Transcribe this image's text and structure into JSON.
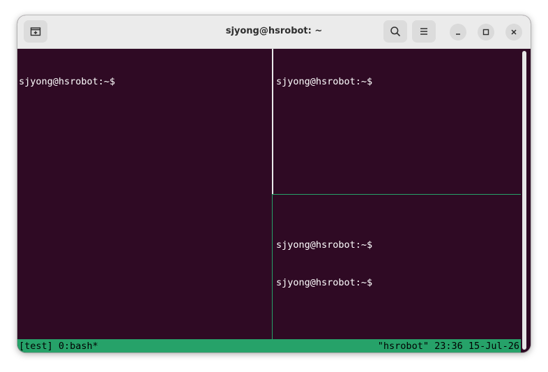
{
  "window": {
    "title": "sjyong@hsrobot: ~"
  },
  "titlebar": {
    "new_tab_icon": "new-tab-icon",
    "search_icon": "search-icon",
    "menu_icon": "hamburger-menu-icon",
    "minimize_icon": "minimize-icon",
    "maximize_icon": "maximize-icon",
    "close_icon": "close-icon"
  },
  "panes": {
    "left": {
      "lines": [
        "sjyong@hsrobot:~$"
      ]
    },
    "top_right": {
      "lines": [
        "sjyong@hsrobot:~$"
      ]
    },
    "bottom_right": {
      "lines": [
        "sjyong@hsrobot:~$",
        "sjyong@hsrobot:~$"
      ]
    }
  },
  "statusbar": {
    "left": "[test] 0:bash*",
    "right": "\"hsrobot\" 23:36 15-Jul-26"
  },
  "colors": {
    "terminal_bg": "#2f0a24",
    "tmux_green": "#26a269",
    "titlebar_bg": "#ebebeb"
  }
}
